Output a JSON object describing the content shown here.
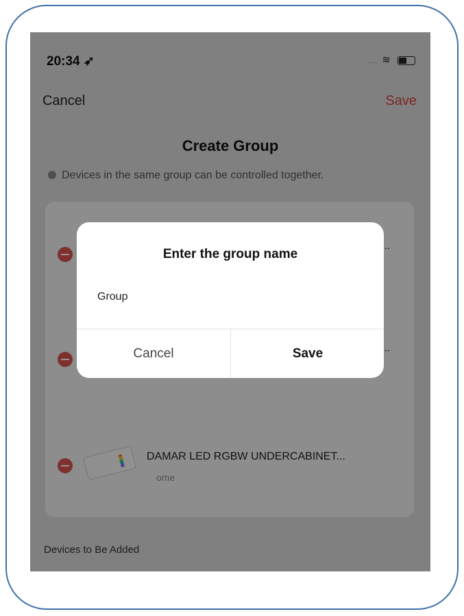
{
  "status_bar": {
    "time": "20:34",
    "location_icon": "location-arrow-icon",
    "signal": "....",
    "wifi_icon": "wifi-icon",
    "battery_icon": "battery-icon"
  },
  "nav": {
    "cancel_label": "Cancel",
    "save_label": "Save",
    "save_color": "#d8473c"
  },
  "title": "Create Group",
  "info_note": "Devices in the same group can be controlled together.",
  "devices": [
    {
      "name_partial": "...",
      "room": ""
    },
    {
      "name_partial": "...",
      "room": ""
    },
    {
      "name": "DAMAR LED RGBW UNDERCABINET...",
      "room": "ome"
    }
  ],
  "section_label": "Devices to Be Added",
  "dialog": {
    "title": "Enter the group name",
    "input_value": "Group",
    "cancel_label": "Cancel",
    "save_label": "Save"
  },
  "colors": {
    "frame_border": "#3f6fa8",
    "remove_red": "#d9534f"
  }
}
